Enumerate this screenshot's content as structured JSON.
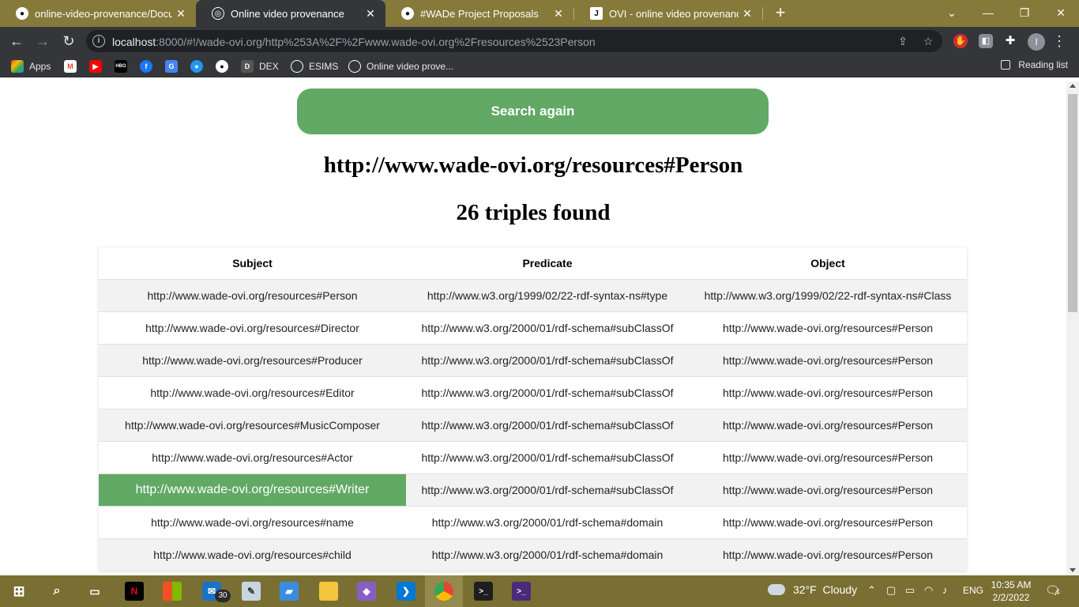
{
  "browser": {
    "tabs": [
      {
        "title": "online-video-provenance/Docum",
        "icon": "github-icon",
        "active": false
      },
      {
        "title": "Online video provenance",
        "icon": "globe-icon",
        "active": true
      },
      {
        "title": "#WADe Project Proposals",
        "icon": "github-icon",
        "active": false
      },
      {
        "title": "OVI - online video provenance - ",
        "icon": "j-icon",
        "active": false
      }
    ],
    "url_host": "localhost",
    "url_rest": ":8000/#!/wade-ovi.org/http%253A%2F%2Fwww.wade-ovi.org%2Fresources%2523Person",
    "bookmarks": [
      {
        "label": "Apps",
        "icon": "apps-grid-icon"
      },
      {
        "label": "",
        "icon": "gmail-icon"
      },
      {
        "label": "",
        "icon": "youtube-icon"
      },
      {
        "label": "",
        "icon": "hbo-icon"
      },
      {
        "label": "",
        "icon": "facebook-icon"
      },
      {
        "label": "",
        "icon": "translate-icon"
      },
      {
        "label": "",
        "icon": "bird-icon"
      },
      {
        "label": "",
        "icon": "github-icon"
      },
      {
        "label": "DEX",
        "icon": "dex-icon"
      },
      {
        "label": "ESIMS",
        "icon": "globe-icon"
      },
      {
        "label": "Online video prove...",
        "icon": "globe-icon"
      }
    ],
    "reading_list": "Reading list",
    "profile_initial": "I"
  },
  "page": {
    "search_again_label": "Search again",
    "resource_title": "http://www.wade-ovi.org/resources#Person",
    "count_title": "26 triples found",
    "table": {
      "headers": [
        "Subject",
        "Predicate",
        "Object"
      ],
      "highlighted_row": 6,
      "rows": [
        [
          "http://www.wade-ovi.org/resources#Person",
          "http://www.w3.org/1999/02/22-rdf-syntax-ns#type",
          "http://www.w3.org/1999/02/22-rdf-syntax-ns#Class"
        ],
        [
          "http://www.wade-ovi.org/resources#Director",
          "http://www.w3.org/2000/01/rdf-schema#subClassOf",
          "http://www.wade-ovi.org/resources#Person"
        ],
        [
          "http://www.wade-ovi.org/resources#Producer",
          "http://www.w3.org/2000/01/rdf-schema#subClassOf",
          "http://www.wade-ovi.org/resources#Person"
        ],
        [
          "http://www.wade-ovi.org/resources#Editor",
          "http://www.w3.org/2000/01/rdf-schema#subClassOf",
          "http://www.wade-ovi.org/resources#Person"
        ],
        [
          "http://www.wade-ovi.org/resources#MusicComposer",
          "http://www.w3.org/2000/01/rdf-schema#subClassOf",
          "http://www.wade-ovi.org/resources#Person"
        ],
        [
          "http://www.wade-ovi.org/resources#Actor",
          "http://www.w3.org/2000/01/rdf-schema#subClassOf",
          "http://www.wade-ovi.org/resources#Person"
        ],
        [
          "http://www.wade-ovi.org/resources#Writer",
          "http://www.w3.org/2000/01/rdf-schema#subClassOf",
          "http://www.wade-ovi.org/resources#Person"
        ],
        [
          "http://www.wade-ovi.org/resources#name",
          "http://www.w3.org/2000/01/rdf-schema#domain",
          "http://www.wade-ovi.org/resources#Person"
        ],
        [
          "http://www.wade-ovi.org/resources#child",
          "http://www.w3.org/2000/01/rdf-schema#domain",
          "http://www.wade-ovi.org/resources#Person"
        ]
      ]
    }
  },
  "taskbar": {
    "apps": [
      {
        "name": "windows-start-icon",
        "label": ""
      },
      {
        "name": "search-icon",
        "label": ""
      },
      {
        "name": "task-view-icon",
        "label": ""
      },
      {
        "name": "netflix-icon",
        "label": "N"
      },
      {
        "name": "store-icon",
        "label": ""
      },
      {
        "name": "mail-icon",
        "label": ""
      },
      {
        "name": "paint-icon",
        "label": ""
      },
      {
        "name": "laptop-icon",
        "label": ""
      },
      {
        "name": "file-explorer-icon",
        "label": ""
      },
      {
        "name": "visual-studio-icon",
        "label": ""
      },
      {
        "name": "vscode-icon",
        "label": ""
      },
      {
        "name": "chrome-icon",
        "label": ""
      },
      {
        "name": "terminal-icon",
        "label": ""
      },
      {
        "name": "powershell-icon",
        "label": ""
      }
    ],
    "mail_badge": "30",
    "weather": "32°F  Cloudy",
    "language": "ENG",
    "time": "10:35 AM",
    "date": "2/2/2022",
    "notifications": "4"
  },
  "colors": {
    "accent_green": "#61a964",
    "tab_strip": "#857a3a",
    "taskbar": "#7a6f33"
  }
}
